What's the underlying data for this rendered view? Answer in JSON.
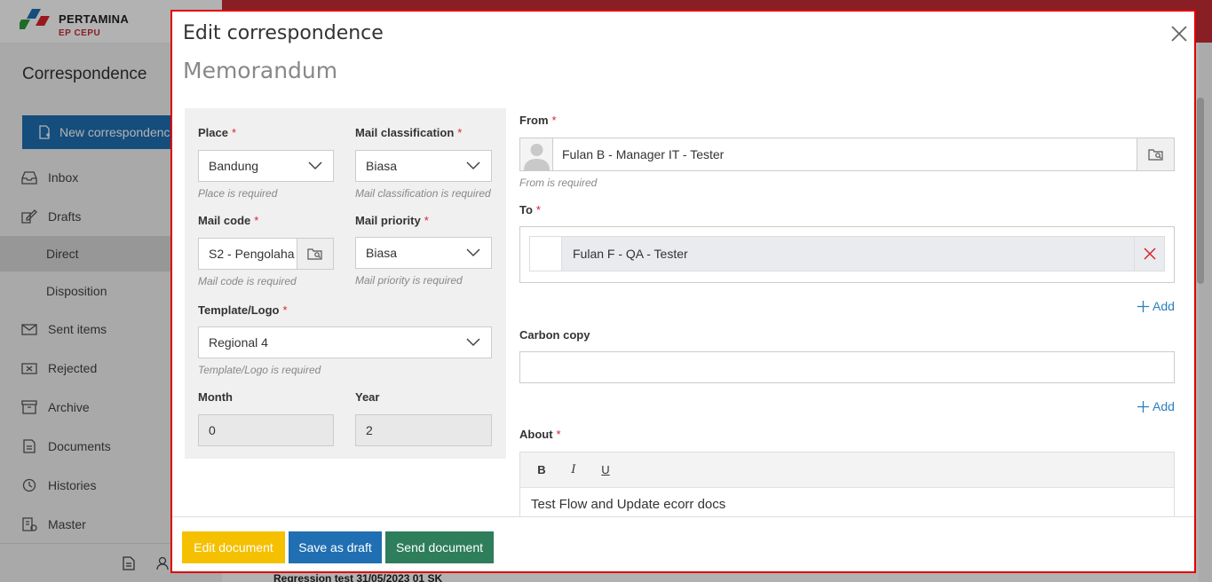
{
  "brand": {
    "name": "PERTAMINA",
    "sub": "EP CEPU",
    "colors": {
      "red": "#c42b36",
      "blue": "#1f6fb2",
      "green": "#2e7d5b",
      "yellow": "#f5c000"
    }
  },
  "app": {
    "title": "Correspondence",
    "new_button": "New correspondence"
  },
  "sidebar": {
    "items": [
      {
        "label": "Inbox",
        "icon": "inbox-icon"
      },
      {
        "label": "Drafts",
        "icon": "drafts-icon"
      },
      {
        "label": "Direct",
        "icon": ""
      },
      {
        "label": "Disposition",
        "icon": ""
      },
      {
        "label": "Sent items",
        "icon": "sent-icon"
      },
      {
        "label": "Rejected",
        "icon": "rejected-icon"
      },
      {
        "label": "Archive",
        "icon": "archive-icon"
      },
      {
        "label": "Documents",
        "icon": "documents-icon"
      },
      {
        "label": "Histories",
        "icon": "history-icon"
      },
      {
        "label": "Master",
        "icon": "master-icon"
      }
    ]
  },
  "background": {
    "row_text": "Regression test 31/05/2023 01 SK"
  },
  "modal": {
    "title": "Edit correspondence",
    "subtitle": "Memorandum",
    "form": {
      "place": {
        "label": "Place",
        "value": "Bandung",
        "hint": "Place is required"
      },
      "mail_classification": {
        "label": "Mail classification",
        "value": "Biasa",
        "hint": "Mail classification is required"
      },
      "mail_code": {
        "label": "Mail code",
        "value": "S2 - Pengolaha",
        "hint": "Mail code is required"
      },
      "mail_priority": {
        "label": "Mail priority",
        "value": "Biasa",
        "hint": "Mail priority is required"
      },
      "template": {
        "label": "Template/Logo",
        "value": "Regional 4",
        "hint": "Template/Logo is required"
      },
      "month": {
        "label": "Month",
        "value": "0"
      },
      "year": {
        "label": "Year",
        "value": "2"
      },
      "from": {
        "label": "From",
        "value": "Fulan B - Manager IT - Tester",
        "hint": "From is required"
      },
      "to": {
        "label": "To",
        "recipient": "Fulan F - QA - Tester",
        "add": "Add"
      },
      "cc": {
        "label": "Carbon copy",
        "add": "Add"
      },
      "about": {
        "label": "About",
        "toolbar": {
          "bold": "B",
          "italic": "I",
          "underline": "U"
        },
        "text": "Test Flow and Update ecorr docs"
      }
    },
    "footer": {
      "edit": "Edit document",
      "draft": "Save as draft",
      "send": "Send document"
    }
  }
}
